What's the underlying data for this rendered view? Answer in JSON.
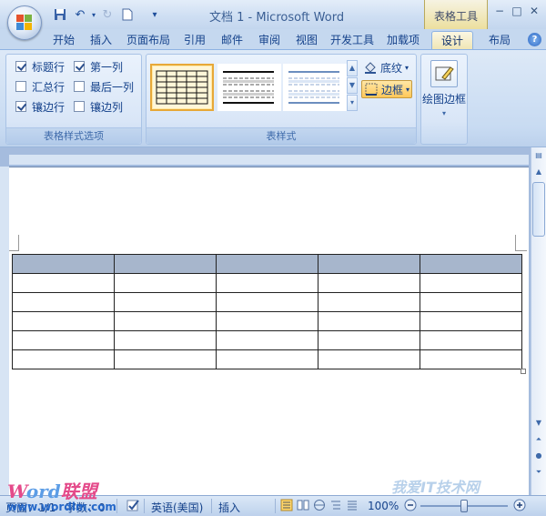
{
  "window": {
    "title": "文档 1 - Microsoft Word",
    "context_tab_title": "表格工具",
    "controls": [
      "−",
      "□",
      "✕"
    ]
  },
  "tabs": [
    {
      "label": "开始"
    },
    {
      "label": "插入"
    },
    {
      "label": "页面布局"
    },
    {
      "label": "引用"
    },
    {
      "label": "邮件"
    },
    {
      "label": "审阅"
    },
    {
      "label": "视图"
    },
    {
      "label": "开发工具"
    },
    {
      "label": "加载项"
    },
    {
      "label": "设计",
      "active": true
    },
    {
      "label": "布局"
    }
  ],
  "ribbon": {
    "style_options": {
      "label": "表格样式选项",
      "options": [
        {
          "label": "标题行",
          "checked": true
        },
        {
          "label": "第一列",
          "checked": true
        },
        {
          "label": "汇总行",
          "checked": false
        },
        {
          "label": "最后一列",
          "checked": false
        },
        {
          "label": "镶边行",
          "checked": true
        },
        {
          "label": "镶边列",
          "checked": false
        }
      ]
    },
    "table_styles": {
      "label": "表样式",
      "shading_label": "底纹",
      "borders_label": "边框"
    },
    "draw_borders": {
      "label": "绘图边框"
    }
  },
  "document": {
    "table": {
      "rows": 6,
      "cols": 5
    }
  },
  "status_bar": {
    "page_label": "页面：1/1",
    "word_count": "字数：0",
    "language": "英语(美国)",
    "insert_mode": "插入",
    "zoom": "100%"
  },
  "watermarks": {
    "left_brand_w": "W",
    "left_brand_ord": "ord",
    "left_brand_cn": "联盟",
    "left_url": "www.wordlm.com",
    "right_text": "我爱IT技术网"
  },
  "colors": {
    "ribbon_bg": "#c8dbf2",
    "header_row": "#a7b6cc",
    "highlight": "#ffc85a"
  }
}
